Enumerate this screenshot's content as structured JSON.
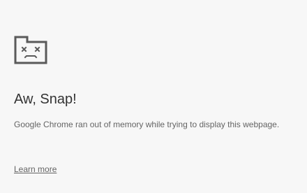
{
  "error_page": {
    "icon": "sad-tab-icon",
    "title": "Aw, Snap!",
    "message": "Google Chrome ran out of memory while trying to display this webpage.",
    "learn_more_label": "Learn more",
    "colors": {
      "background": "#f7f7f7",
      "icon": "#5a5a5a",
      "title": "#333333",
      "text": "#646464"
    }
  }
}
